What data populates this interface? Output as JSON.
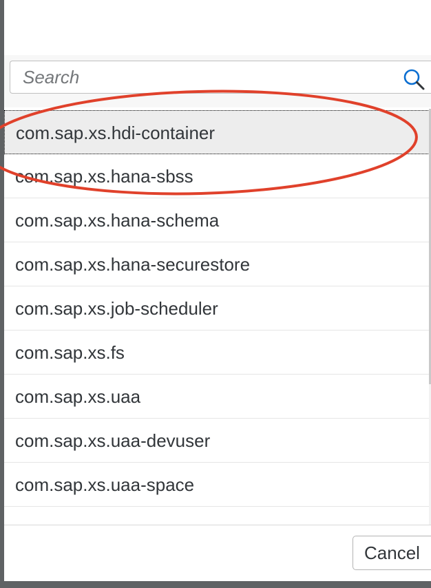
{
  "search": {
    "placeholder": "Search",
    "icon": "search-icon"
  },
  "services": [
    {
      "label": "com.sap.xs.hdi-container",
      "selected": true
    },
    {
      "label": "com.sap.xs.hana-sbss",
      "selected": false
    },
    {
      "label": "com.sap.xs.hana-schema",
      "selected": false
    },
    {
      "label": "com.sap.xs.hana-securestore",
      "selected": false
    },
    {
      "label": "com.sap.xs.job-scheduler",
      "selected": false
    },
    {
      "label": "com.sap.xs.fs",
      "selected": false
    },
    {
      "label": "com.sap.xs.uaa",
      "selected": false
    },
    {
      "label": "com.sap.xs.uaa-devuser",
      "selected": false
    },
    {
      "label": "com.sap.xs.uaa-space",
      "selected": false
    }
  ],
  "footer": {
    "cancel_label": "Cancel"
  },
  "colors": {
    "annotation": "#e0412b",
    "selected_background": "#ededed",
    "overlay": "#5f6264"
  }
}
